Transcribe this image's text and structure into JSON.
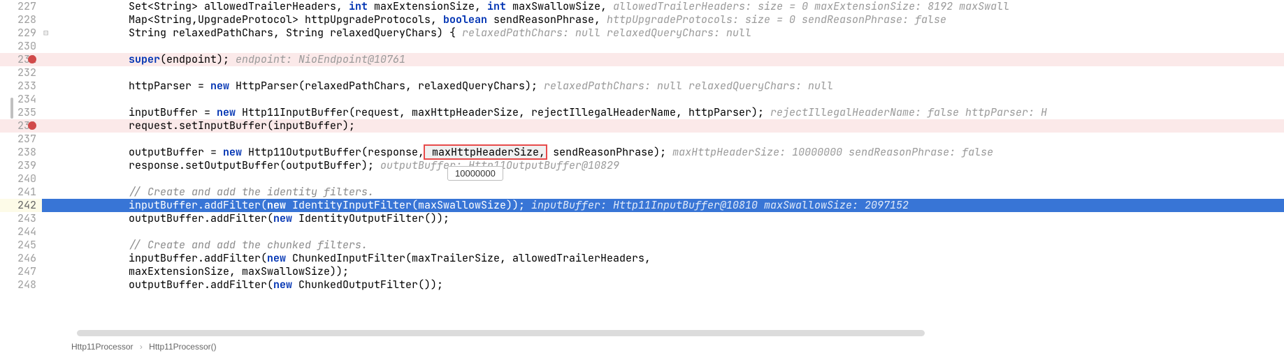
{
  "tooltip": "10000000",
  "breadcrumb": {
    "a": "Http11Processor",
    "b": "Http11Processor()"
  },
  "lines": [
    {
      "n": 227,
      "cls": "",
      "html": "        Set&lt;String&gt; allowedTrailerHeaders, <span class='kw'>int</span> maxExtensionSize, <span class='kw'>int</span> maxSwallowSize,   <span class='hint'>allowedTrailerHeaders:  size = 0   maxExtensionSize: 8192   maxSwall</span>"
    },
    {
      "n": 228,
      "cls": "",
      "html": "        Map&lt;String,UpgradeProtocol&gt; httpUpgradeProtocols, <span class='kw'>boolean</span> sendReasonPhrase,   <span class='hint'>httpUpgradeProtocols:  size = 0   sendReasonPhrase: false</span>"
    },
    {
      "n": 229,
      "cls": "",
      "fold": "⊟",
      "html": "        String relaxedPathChars, String relaxedQueryChars) {   <span class='hint'>relaxedPathChars: null   relaxedQueryChars: null</span>"
    },
    {
      "n": 230,
      "cls": "",
      "html": ""
    },
    {
      "n": 231,
      "cls": "bp-row",
      "bp": true,
      "html": "    <span class='kw'>super</span>(endpoint);   <span class='hint'>endpoint: NioEndpoint@10761</span>"
    },
    {
      "n": 232,
      "cls": "",
      "html": ""
    },
    {
      "n": 233,
      "cls": "",
      "html": "    httpParser = <span class='kw'>new</span> HttpParser(relaxedPathChars, relaxedQueryChars);   <span class='hint'>relaxedPathChars: null   relaxedQueryChars: null</span>"
    },
    {
      "n": 234,
      "cls": "",
      "html": ""
    },
    {
      "n": 235,
      "cls": "",
      "html": "    inputBuffer = <span class='kw'>new</span> Http11InputBuffer(request, maxHttpHeaderSize, rejectIllegalHeaderName, httpParser);   <span class='hint'>rejectIllegalHeaderName: false   httpParser: H</span>"
    },
    {
      "n": 236,
      "cls": "bp-row",
      "bp": true,
      "html": "    request.setInputBuffer(inputBuffer);"
    },
    {
      "n": 237,
      "cls": "",
      "html": ""
    },
    {
      "n": 238,
      "cls": "",
      "html": "    outputBuffer = <span class='kw'>new</span> Http11OutputBuffer(response,<span class='hover'> maxHttpHeaderSize,</span> sendReasonPhrase);   <span class='hint'>maxHttpHeaderSize: 10000000   sendReasonPhrase: false</span>"
    },
    {
      "n": 239,
      "cls": "",
      "html": "    response.setOutputBuffer(outputBuffer);   <span class='hint'>outputBuffer: Http11OutputBuffer@10829</span>"
    },
    {
      "n": 240,
      "cls": "",
      "html": ""
    },
    {
      "n": 241,
      "cls": "",
      "html": "    <span class='cmt'>// Create and add the identity filters.</span>"
    },
    {
      "n": 242,
      "cls": "exec",
      "curr": true,
      "html": "    inputBuffer.addFilter(<span class='kw'>new</span> IdentityInputFilter(maxSwallowSize));   <span class='hint'>inputBuffer: Http11InputBuffer@10810   maxSwallowSize: 2097152</span>"
    },
    {
      "n": 243,
      "cls": "",
      "html": "    outputBuffer.addFilter(<span class='kw'>new</span> IdentityOutputFilter());"
    },
    {
      "n": 244,
      "cls": "",
      "html": ""
    },
    {
      "n": 245,
      "cls": "",
      "html": "    <span class='cmt'>// Create and add the chunked filters.</span>"
    },
    {
      "n": 246,
      "cls": "",
      "html": "    inputBuffer.addFilter(<span class='kw'>new</span> ChunkedInputFilter(maxTrailerSize, allowedTrailerHeaders,"
    },
    {
      "n": 247,
      "cls": "",
      "html": "            maxExtensionSize, maxSwallowSize));"
    },
    {
      "n": 248,
      "cls": "",
      "html": "    outputBuffer.addFilter(<span class='kw'>new</span> ChunkedOutputFilter());"
    }
  ]
}
